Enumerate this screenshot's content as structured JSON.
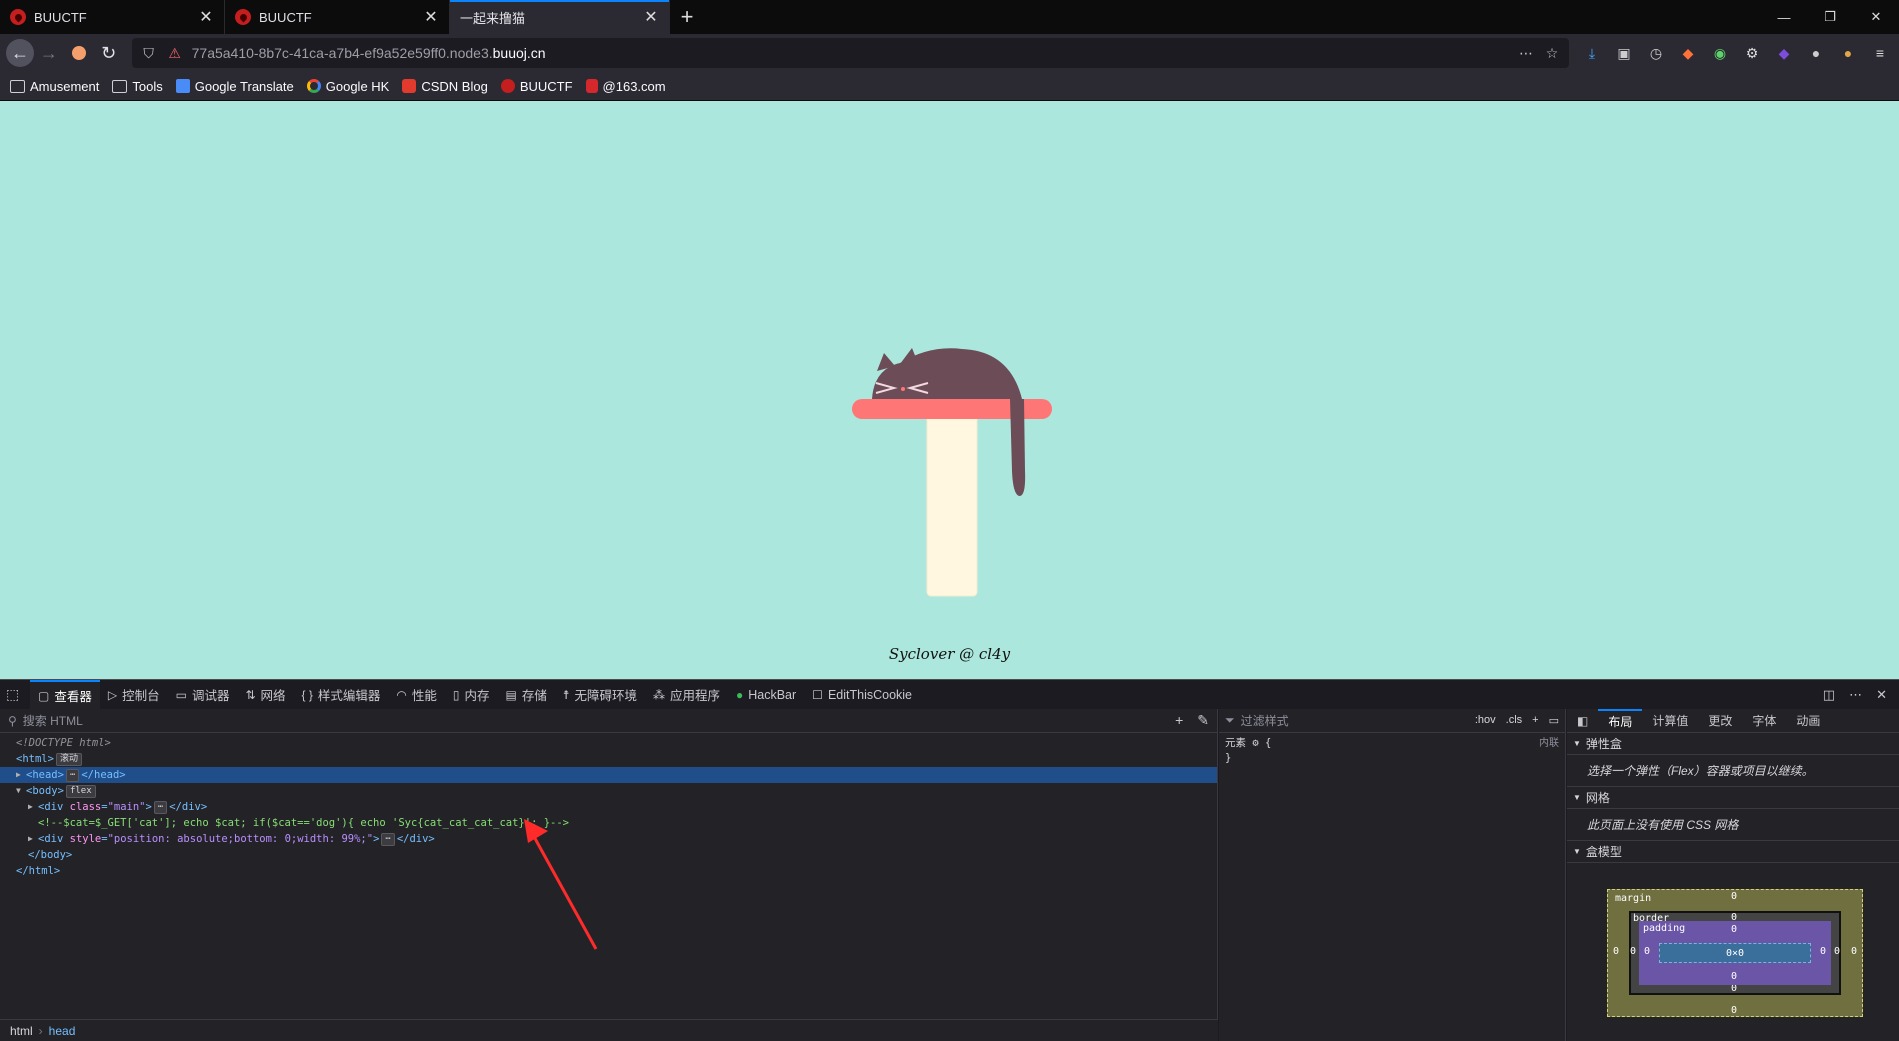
{
  "tabs": [
    {
      "title": "BUUCTF",
      "active": false
    },
    {
      "title": "BUUCTF",
      "active": false
    },
    {
      "title": "一起来撸猫",
      "active": true
    }
  ],
  "nav": {
    "url_prefix": "77a5a410-8b7c-41ca-a7b4-ef9a52e59ff0.node3.",
    "url_domain": "buuoj.cn"
  },
  "bookmarks": [
    {
      "label": "Amusement",
      "icon": "folder-icon"
    },
    {
      "label": "Tools",
      "icon": "folder-icon"
    },
    {
      "label": "Google Translate",
      "icon": "google-translate-icon"
    },
    {
      "label": "Google HK",
      "icon": "google-icon"
    },
    {
      "label": "CSDN Blog",
      "icon": "csdn-icon"
    },
    {
      "label": "BUUCTF",
      "icon": "buuctf-icon"
    },
    {
      "label": "@163.com",
      "icon": "mail-163-icon"
    }
  ],
  "page": {
    "signature": "Syclover @ cl4y",
    "colors": {
      "background": "#ace7dd",
      "cat": "#6b4c57",
      "perch": "#ff7676",
      "post": "#fff7df"
    }
  },
  "devtools": {
    "tabs": [
      {
        "label": "查看器",
        "icon": "inspector-icon",
        "active": true
      },
      {
        "label": "控制台",
        "icon": "console-icon",
        "active": false
      },
      {
        "label": "调试器",
        "icon": "debugger-icon",
        "active": false
      },
      {
        "label": "网络",
        "icon": "network-icon",
        "active": false
      },
      {
        "label": "样式编辑器",
        "icon": "style-editor-icon",
        "active": false
      },
      {
        "label": "性能",
        "icon": "performance-icon",
        "active": false
      },
      {
        "label": "内存",
        "icon": "memory-icon",
        "active": false
      },
      {
        "label": "存储",
        "icon": "storage-icon",
        "active": false
      },
      {
        "label": "无障碍环境",
        "icon": "accessibility-icon",
        "active": false
      },
      {
        "label": "应用程序",
        "icon": "application-icon",
        "active": false
      },
      {
        "label": "HackBar",
        "icon": "hackbar-icon",
        "active": false
      },
      {
        "label": "EditThisCookie",
        "icon": "cookie-icon",
        "active": false
      }
    ],
    "search_placeholder": "搜索 HTML",
    "markup": {
      "doctype": "<!DOCTYPE html>",
      "html_open": "<html>",
      "scroll_badge": "滚动",
      "head_open": "<head>",
      "head_close": "</head>",
      "ellipsis_badge": "⋯",
      "body_open": "<body>",
      "flex_badge": "flex",
      "div_open": "<div",
      "attr_class": "class",
      "attr_class_value": "\"main\"",
      "attr_style": "style",
      "attr_style_value": "\"position: absolute;bottom: 0;width: 99%;\"",
      "tag_gt": ">",
      "eq": "=",
      "div_close": "</div>",
      "comment": "<!--$cat=$_GET['cat']; echo $cat; if($cat=='dog'){ echo 'Syc{cat_cat_cat_cat}'; }-->",
      "body_close": "</body>",
      "html_close": "</html>"
    },
    "breadcrumbs": [
      "html",
      "head"
    ],
    "rules": {
      "filter_placeholder": "过滤样式",
      "hov": ":hov",
      "cls": ".cls",
      "element_selector": "元素",
      "open_brace": "{",
      "close_brace": "}",
      "inline_label": "内联"
    },
    "layout": {
      "tabs": [
        "布局",
        "计算值",
        "更改",
        "字体",
        "动画"
      ],
      "flexbox_title": "弹性盒",
      "flexbox_msg": "选择一个弹性（Flex）容器或项目以继续。",
      "grid_title": "网格",
      "grid_msg": "此页面上没有使用 CSS 网格",
      "boxmodel_title": "盒模型",
      "box": {
        "margin": "margin",
        "border": "border",
        "padding": "padding",
        "content": "0×0",
        "zero": "0"
      }
    }
  }
}
